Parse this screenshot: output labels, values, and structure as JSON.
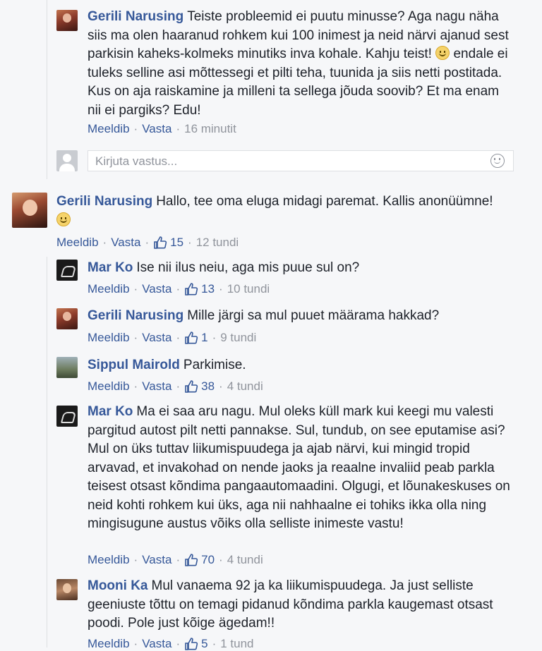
{
  "comments": [
    {
      "author": "Gerili Narusing",
      "text_before_emoji": "Teiste probleemid ei puutu minusse? Aga nagu näha siis ma olen haaranud rohkem kui 100 inimest ja neid närvi ajanud sest parkisin kaheks-kolmeks minutiks inva kohale. Kahju teist!",
      "text_after_emoji": "endale ei tuleks selline asi mõttessegi et pilti teha, tuunida ja siis netti postitada. Kus on aja raiskamine ja milleni ta sellega jõuda soovib? Et ma enam nii ei pargiks? Edu!",
      "like_label": "Meeldib",
      "reply_label": "Vasta",
      "time": "16 minutit"
    },
    {
      "author": "Gerili Narusing",
      "text": "Hallo, tee oma eluga midagi paremat. Kallis anonüümne!",
      "like_label": "Meeldib",
      "reply_label": "Vasta",
      "likes": "15",
      "time": "12 tundi"
    }
  ],
  "reply_input": {
    "placeholder": "Kirjuta vastus...",
    "icon": "emoji-icon"
  },
  "replies": [
    {
      "author": "Mar Ko",
      "text": "Ise nii ilus neiu, aga mis puue sul on?",
      "like_label": "Meeldib",
      "reply_label": "Vasta",
      "likes": "13",
      "time": "10 tundi"
    },
    {
      "author": "Gerili Narusing",
      "text": "Mille järgi sa mul puuet määrama hakkad?",
      "like_label": "Meeldib",
      "reply_label": "Vasta",
      "likes": "1",
      "time": "9 tundi"
    },
    {
      "author": "Sippul Mairold",
      "text": "Parkimise.",
      "like_label": "Meeldib",
      "reply_label": "Vasta",
      "likes": "38",
      "time": "4 tundi"
    },
    {
      "author": "Mar Ko",
      "text": "Ma ei saa aru nagu. Mul oleks küll mark kui keegi mu valesti pargitud autost pilt netti pannakse. Sul, tundub, on see eputamise asi? Mul on üks tuttav liikumispuudega ja ajab närvi, kui mingid tropid arvavad, et invakohad on nende jaoks ja reaalne invaliid peab parkla teisest otsast kõndima pangaautomaadini. Olgugi, et lõunakeskuses on neid kohti rohkem kui üks, aga nii nahhaalne ei tohiks ikka olla ning mingisugune austus võiks olla selliste inimeste vastu!",
      "like_label": "Meeldib",
      "reply_label": "Vasta",
      "likes": "70",
      "time": "4 tundi"
    },
    {
      "author": "Mooni Ka",
      "text": "Mul vanaema 92 ja ka liikumispuudega. Ja just selliste geeniuste tõttu on temagi pidanud kõndima parkla kaugemast otsast poodi. Pole just kõige ägedam!!",
      "like_label": "Meeldib",
      "reply_label": "Vasta",
      "likes": "5",
      "time": "1 tund"
    }
  ],
  "colors": {
    "link": "#365899",
    "meta": "#90949c",
    "text": "#1d2129",
    "background": "#f6f7f9"
  }
}
